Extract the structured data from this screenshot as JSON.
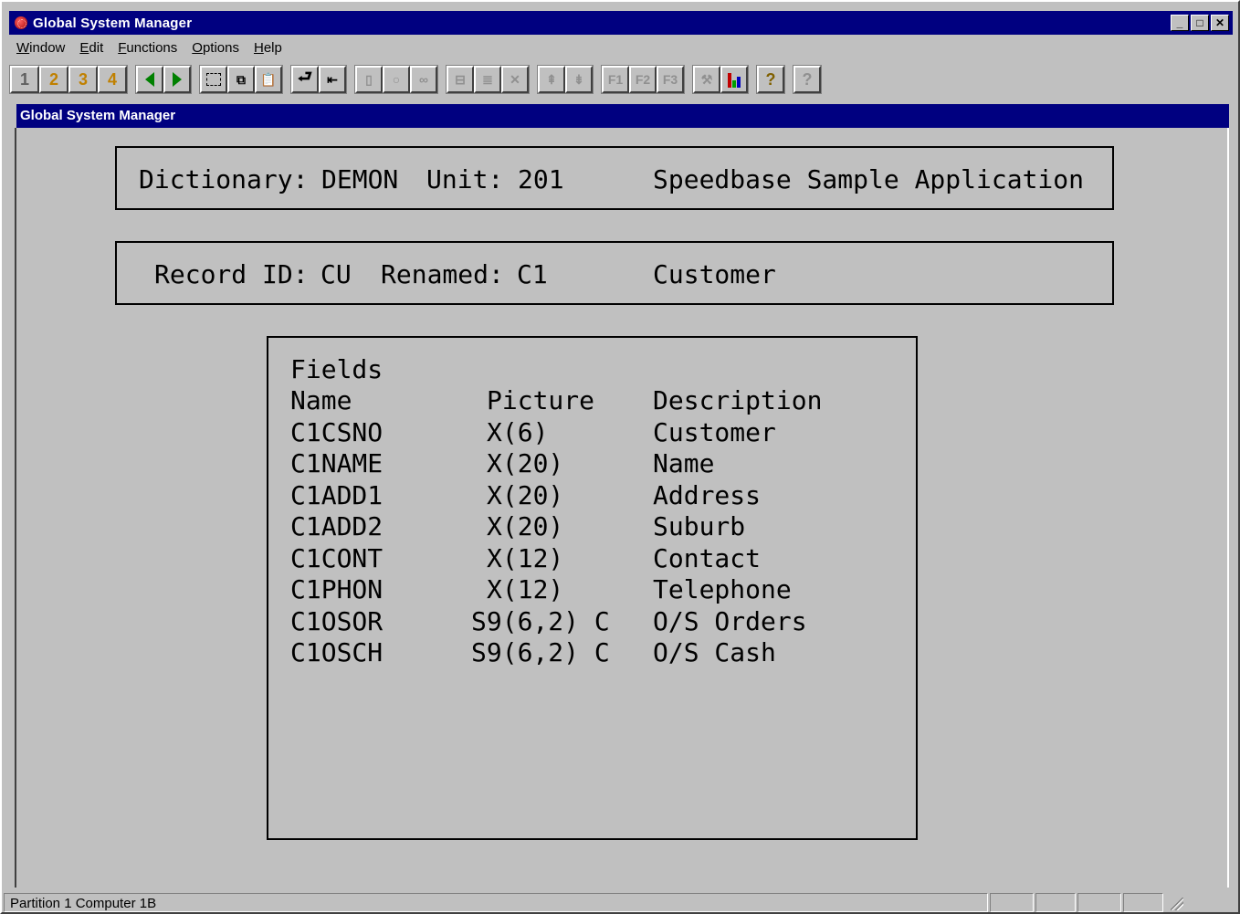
{
  "window": {
    "title": "Global System Manager"
  },
  "menu": [
    {
      "label": "Window",
      "ul": "W",
      "rest": "indow"
    },
    {
      "label": "Edit",
      "ul": "E",
      "rest": "dit"
    },
    {
      "label": "Functions",
      "ul": "F",
      "rest": "unctions"
    },
    {
      "label": "Options",
      "ul": "O",
      "rest": "ptions"
    },
    {
      "label": "Help",
      "ul": "H",
      "rest": "elp"
    }
  ],
  "toolbar": {
    "b1": "1",
    "b2": "2",
    "b3": "3",
    "b4": "4"
  },
  "child": {
    "title": "Global System Manager"
  },
  "screen": {
    "dict_label": "Dictionary:",
    "dict_value": "DEMON",
    "unit_label": "Unit:",
    "unit_value": "201",
    "app_name": "Speedbase Sample Application",
    "record_label": "Record ID:",
    "record_value": "CU",
    "renamed_label": "Renamed:",
    "renamed_value": "C1",
    "record_desc": "Customer",
    "fields_heading": "Fields",
    "col_name": "Name",
    "col_picture": "Picture",
    "col_desc": "Description",
    "rows": [
      {
        "name": "C1CSNO",
        "picture": "X(6)",
        "desc": "Customer"
      },
      {
        "name": "C1NAME",
        "picture": "X(20)",
        "desc": "Name"
      },
      {
        "name": "C1ADD1",
        "picture": "X(20)",
        "desc": "Address"
      },
      {
        "name": "C1ADD2",
        "picture": "X(20)",
        "desc": "Suburb"
      },
      {
        "name": "C1CONT",
        "picture": "X(12)",
        "desc": "Contact"
      },
      {
        "name": "C1PHON",
        "picture": "X(12)",
        "desc": "Telephone"
      },
      {
        "name": "C1OSOR",
        "picture": "S9(6,2) C",
        "desc": "O/S Orders"
      },
      {
        "name": "C1OSCH",
        "picture": "S9(6,2) C",
        "desc": "O/S Cash"
      }
    ]
  },
  "status": {
    "text": "Partition 1 Computer 1B"
  }
}
